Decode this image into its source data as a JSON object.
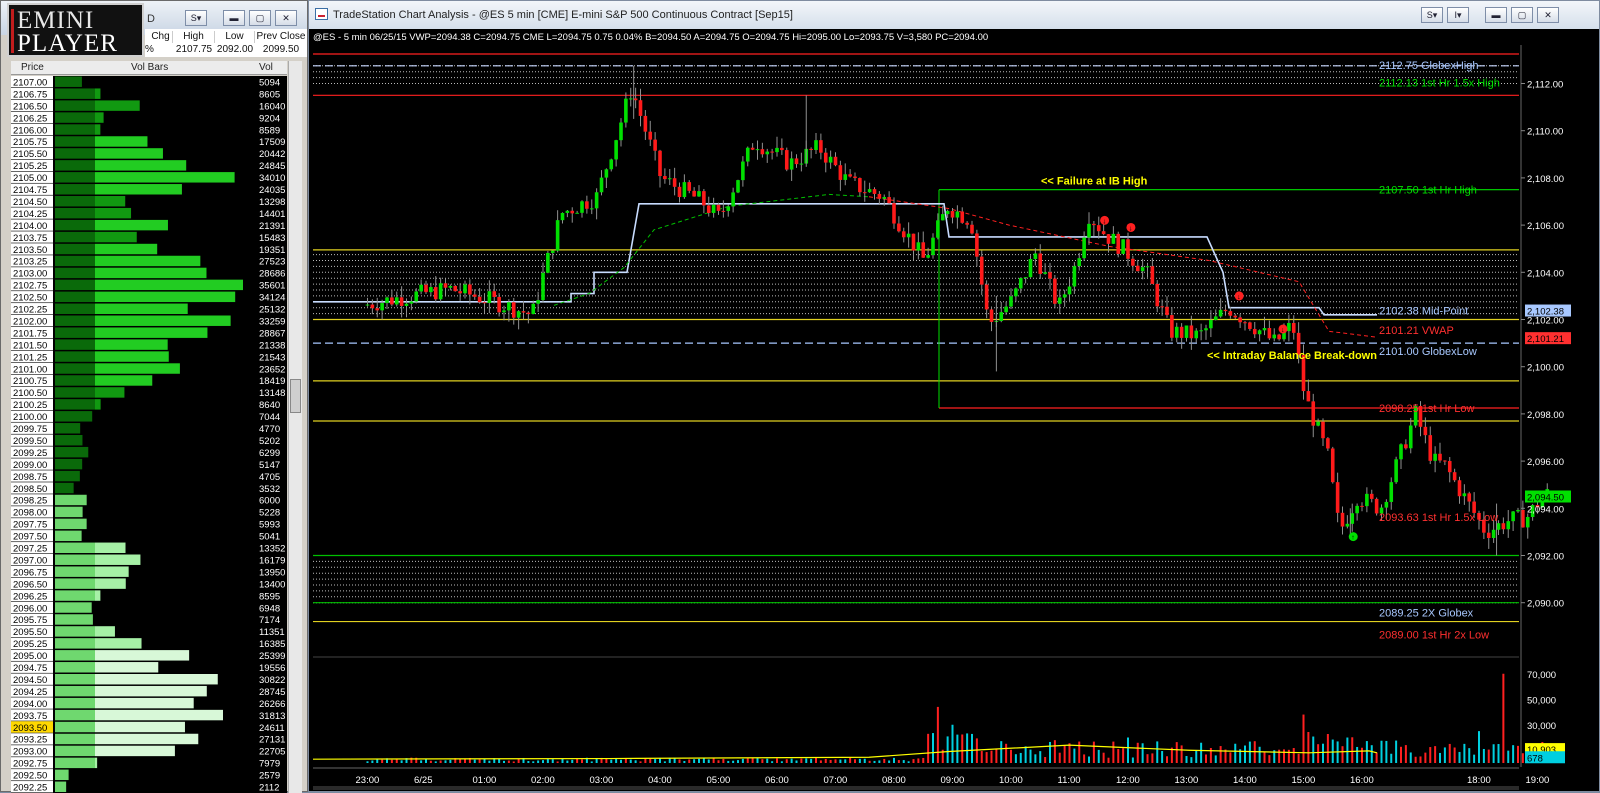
{
  "logo": {
    "line1": "EMINI",
    "line2": "PLAYER"
  },
  "left_window": {
    "title_fragment": "D",
    "quote_headers": [
      "Chg",
      "High",
      "Low",
      "Prev Close"
    ],
    "quote_values": [
      "%",
      "2107.75",
      "2092.00",
      "2099.50"
    ],
    "columns": [
      "Price",
      "Vol Bars",
      "Vol"
    ],
    "current_price": "2093.50"
  },
  "volume_profile": [
    [
      "2107.00",
      5094
    ],
    [
      "2106.75",
      8605
    ],
    [
      "2106.50",
      16040
    ],
    [
      "2106.25",
      9204
    ],
    [
      "2106.00",
      8589
    ],
    [
      "2105.75",
      17509
    ],
    [
      "2105.50",
      20442
    ],
    [
      "2105.25",
      24845
    ],
    [
      "2105.00",
      34010
    ],
    [
      "2104.75",
      24035
    ],
    [
      "2104.50",
      13298
    ],
    [
      "2104.25",
      14401
    ],
    [
      "2104.00",
      21391
    ],
    [
      "2103.75",
      15483
    ],
    [
      "2103.50",
      19351
    ],
    [
      "2103.25",
      27523
    ],
    [
      "2103.00",
      28686
    ],
    [
      "2102.75",
      35601
    ],
    [
      "2102.50",
      34124
    ],
    [
      "2102.25",
      25132
    ],
    [
      "2102.00",
      33259
    ],
    [
      "2101.75",
      28867
    ],
    [
      "2101.50",
      21338
    ],
    [
      "2101.25",
      21543
    ],
    [
      "2101.00",
      23652
    ],
    [
      "2100.75",
      18419
    ],
    [
      "2100.50",
      13148
    ],
    [
      "2100.25",
      8640
    ],
    [
      "2100.00",
      7044
    ],
    [
      "2099.75",
      4770
    ],
    [
      "2099.50",
      5202
    ],
    [
      "2099.25",
      6299
    ],
    [
      "2099.00",
      5147
    ],
    [
      "2098.75",
      4705
    ],
    [
      "2098.50",
      3532
    ],
    [
      "2098.25",
      6000
    ],
    [
      "2098.00",
      5228
    ],
    [
      "2097.75",
      5993
    ],
    [
      "2097.50",
      5041
    ],
    [
      "2097.25",
      13352
    ],
    [
      "2097.00",
      16179
    ],
    [
      "2096.75",
      13950
    ],
    [
      "2096.50",
      13400
    ],
    [
      "2096.25",
      8595
    ],
    [
      "2096.00",
      6948
    ],
    [
      "2095.75",
      7174
    ],
    [
      "2095.50",
      11351
    ],
    [
      "2095.25",
      16385
    ],
    [
      "2095.00",
      25399
    ],
    [
      "2094.75",
      19556
    ],
    [
      "2094.50",
      30822
    ],
    [
      "2094.25",
      28745
    ],
    [
      "2094.00",
      26266
    ],
    [
      "2093.75",
      31813
    ],
    [
      "2093.50",
      24611
    ],
    [
      "2093.25",
      27131
    ],
    [
      "2093.00",
      22705
    ],
    [
      "2092.75",
      7979
    ],
    [
      "2092.50",
      2579
    ],
    [
      "2092.25",
      2112
    ]
  ],
  "chart_window": {
    "title": "TradeStation Chart Analysis - @ES 5 min [CME] E-mini S&P 500 Continuous Contract [Sep15]",
    "status_line": "@ES - 5 min  06/25/15  VWP=2094.38  C=2094.75  CME  L=2094.75  0.75  0.04%  B=2094.50  A=2094.75  O=2094.75  Hi=2095.00  Lo=2093.75  V=3,580  PC=2094.00"
  },
  "price_axis": [
    "2,112.00",
    "2,110.00",
    "2,108.00",
    "2,106.00",
    "2,104.00",
    "2,102.00",
    "2,100.00",
    "2,098.00",
    "2,096.00",
    "2,094.00",
    "2,092.00",
    "2,090.00"
  ],
  "price_axis_badges": [
    {
      "text": "2,102.38",
      "color": "#a8c8ff"
    },
    {
      "text": "2,101.21",
      "color": "#ff3030"
    },
    {
      "text": "2,094.50",
      "color": "#00e000"
    }
  ],
  "volume_axis": [
    "70,000",
    "50,000",
    "30,000",
    "10,000"
  ],
  "volume_badges": [
    {
      "text": "10,903",
      "color": "#ffff00"
    },
    {
      "text": "678",
      "color": "#00cfe0"
    }
  ],
  "time_axis": [
    "23:00",
    "6/25",
    "01:00",
    "02:00",
    "03:00",
    "04:00",
    "05:00",
    "06:00",
    "07:00",
    "08:00",
    "09:00",
    "10:00",
    "11:00",
    "12:00",
    "13:00",
    "14:00",
    "15:00",
    "16:00",
    "18:00",
    "19:00"
  ],
  "level_labels": [
    {
      "text": "2112.75 GlobexHigh",
      "color": "#a8c8ff"
    },
    {
      "text": "2112.13 1st Hr  1.5x High",
      "color": "#00e000"
    },
    {
      "text": "2107.50 1st Hr  High",
      "color": "#00e000"
    },
    {
      "text": "2102.38 Mid-Point",
      "color": "#a8c8ff"
    },
    {
      "text": "2101.21 VWAP",
      "color": "#ff3030"
    },
    {
      "text": "2101.00 GlobexLow",
      "color": "#a8c8ff"
    },
    {
      "text": "2098.25 1st Hr  Low",
      "color": "#ff3030"
    },
    {
      "text": "2093.63 1st Hr  1.5x Low",
      "color": "#ff3030"
    },
    {
      "text": "2089.25 2X Globex",
      "color": "#a8c8ff"
    },
    {
      "text": "2089.00 1st Hr  2x Low",
      "color": "#ff3030"
    }
  ],
  "annotations": [
    {
      "text": "<< Failure at IB High",
      "color": "#ffff00"
    },
    {
      "text": "<< Intraday Balance Break-down",
      "color": "#ffff00"
    }
  ],
  "colors": {
    "bull": "#00e000",
    "bear": "#ff1a1a",
    "wick": "#909090",
    "background": "#000000"
  }
}
